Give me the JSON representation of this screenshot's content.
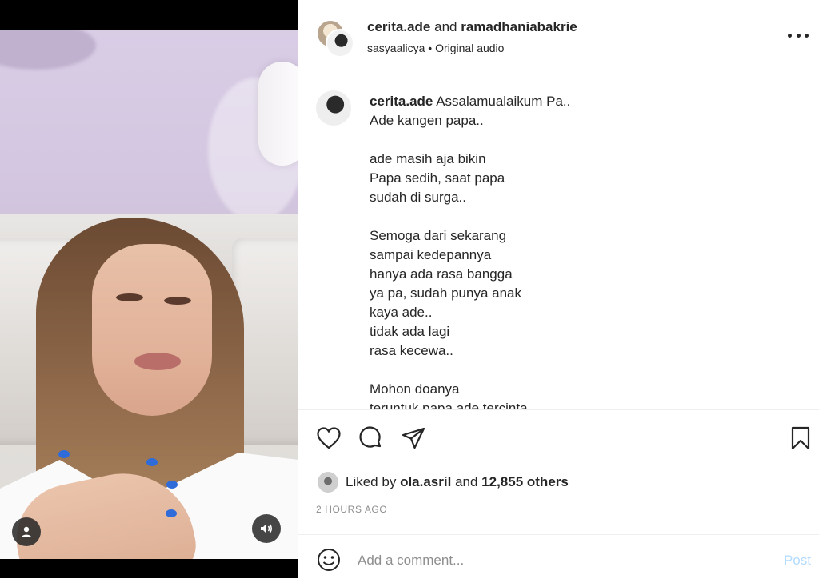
{
  "header": {
    "user1": "cerita.ade",
    "connector": "and",
    "user2": "ramadhaniabakrie",
    "sub_user": "sasyaalicya",
    "separator": "•",
    "audio": "Original audio",
    "icons": {
      "avatar": "profile-avatar",
      "more": "more-options-icon"
    }
  },
  "caption": {
    "username": "cerita.ade",
    "lines": [
      "Assalamualaikum Pa..",
      "Ade kangen papa..",
      "",
      "ade masih aja bikin",
      "Papa sedih, saat papa",
      "sudah di surga..",
      "",
      "Semoga dari sekarang",
      "sampai kedepannya",
      "hanya ada rasa bangga",
      "ya pa, sudah punya anak",
      "kaya ade..",
      "tidak ada lagi",
      "rasa kecewa..",
      "",
      "Mohon doanya",
      "teruntuk papa ade tercinta"
    ]
  },
  "actions": {
    "icons": [
      "heart-icon",
      "comment-icon",
      "share-icon",
      "bookmark-icon"
    ]
  },
  "likes": {
    "prefix": "Liked by",
    "user": "ola.asril",
    "connector": "and",
    "others": "12,855 others"
  },
  "timestamp": "2 HOURS AGO",
  "comment": {
    "placeholder": "Add a comment...",
    "post_label": "Post"
  },
  "video": {
    "icons": [
      "user-tag-icon",
      "volume-icon"
    ]
  },
  "colors": {
    "text": "#262626",
    "muted": "#8e8e8e",
    "post_disabled": "#b3dbff",
    "nail_polish": "#2f6bd9"
  }
}
